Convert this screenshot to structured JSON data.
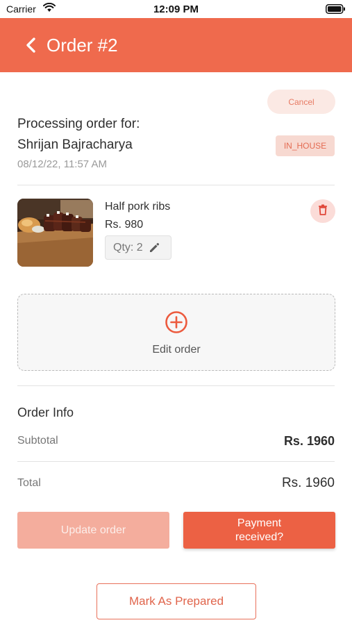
{
  "status_bar": {
    "carrier": "Carrier",
    "time": "12:09 PM",
    "wifi_icon": "wifi-icon",
    "battery_icon": "battery-icon"
  },
  "header": {
    "title": "Order #2",
    "back_icon": "chevron-left-icon",
    "background_color": "#ef6a4d"
  },
  "order": {
    "cancel_label": "Cancel",
    "processing_label": "Processing order for:",
    "customer_name": "Shrijan Bajracharya",
    "timestamp": "08/12/22,  11:57 AM",
    "order_type": "IN_HOUSE"
  },
  "items": [
    {
      "name": "Half pork ribs",
      "price": "Rs. 980",
      "quantity": "Qty: 2",
      "edit_icon": "pencil-icon",
      "delete_icon": "trash-icon"
    }
  ],
  "edit_order": {
    "label": "Edit order",
    "icon": "plus-circle-icon"
  },
  "order_info": {
    "title": "Order Info",
    "subtotal_label": "Subtotal",
    "subtotal_value": "Rs. 1960",
    "total_label": "Total",
    "total_value": "Rs. 1960"
  },
  "actions": {
    "update_order": "Update order",
    "payment_received_line1": "Payment",
    "payment_received_line2": "received?",
    "mark_prepared": "Mark As Prepared"
  },
  "colors": {
    "accent": "#ec6144",
    "accent_light": "#f4ad9d",
    "badge_bg": "#f7d9d1"
  }
}
